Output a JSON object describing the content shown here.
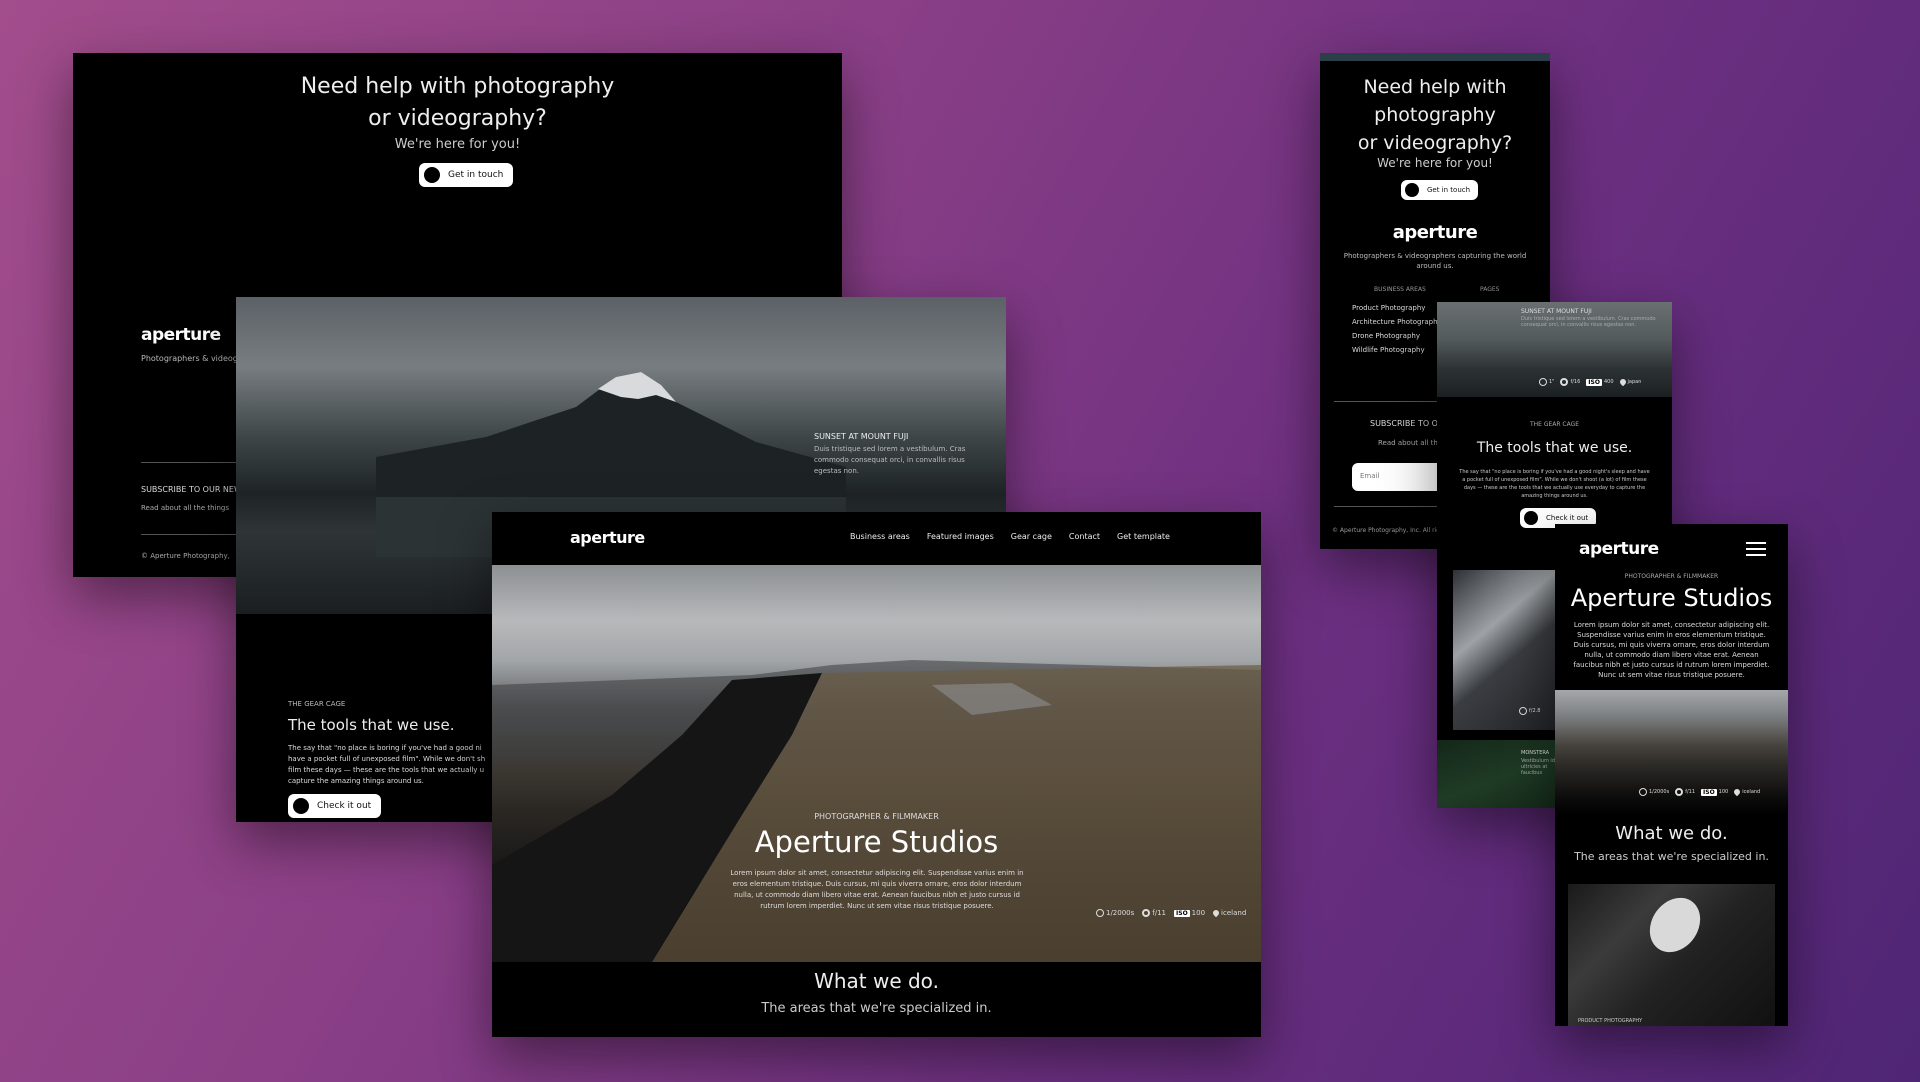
{
  "screen_footer_desktop": {
    "cta_title_line1": "Need help with photography",
    "cta_title_line2": "or videography?",
    "cta_subtitle": "We're here for you!",
    "cta_button": "Get in touch",
    "logo": "aperture",
    "tagline": "Photographers & videogr",
    "subscribe_heading": "SUBSCRIBE TO OUR NEW",
    "subscribe_text": "Read about all the things",
    "copyright": "© Aperture Photography,"
  },
  "screen_featured_desktop": {
    "caption_title": "SUNSET AT MOUNT FUJI",
    "caption_text": "Duis tristique sed lorem a vestibulum. Cras commodo consequat orci, in convallis risus egestas non.",
    "gear_eyebrow": "THE GEAR CAGE",
    "gear_title": "The tools that we use.",
    "gear_text": "The say that \"no place is boring if you've had a good ni have a pocket full of unexposed film\". While we don't sh film these days — these are the tools that we actually u capture the amazing things around us.",
    "gear_button": "Check it out"
  },
  "screen_hero_desktop": {
    "logo": "aperture",
    "nav": [
      "Business areas",
      "Featured images",
      "Gear cage",
      "Contact",
      "Get template"
    ],
    "eyebrow": "PHOTOGRAPHER & FILMMAKER",
    "title": "Aperture Studios",
    "text": "Lorem ipsum dolor sit amet, consectetur adipiscing elit. Suspendisse varius enim in eros elementum tristique. Duis cursus, mi quis viverra ornare, eros dolor interdum nulla, ut commodo diam libero vitae erat. Aenean faucibus nibh et justo cursus id rutrum lorem imperdiet. Nunc ut sem vitae risus tristique posuere.",
    "meta": {
      "shutter": "1/2000s",
      "aperture": "f/11",
      "iso_label": "ISO",
      "iso": "100",
      "location": "iceland"
    },
    "section_title": "What we do.",
    "section_sub": "The areas that we're specialized in."
  },
  "screen_footer_mobile": {
    "cta_title_line1": "Need help with",
    "cta_title_line2": "photography",
    "cta_title_line3": "or videography?",
    "cta_subtitle": "We're here for you!",
    "cta_button": "Get in touch",
    "logo": "aperture",
    "tagline": "Photographers & videographers capturing the world around us.",
    "col_business": "BUSINESS AREAS",
    "col_pages": "PAGES",
    "business_links": [
      "Product Photography",
      "Architecture Photography",
      "Drone Photography",
      "Wildlife Photography"
    ],
    "subscribe_heading": "SUBSCRIBE TO O",
    "subscribe_text": "Read about all th",
    "email_placeholder": "Email",
    "copyright": "© Aperture Photography, Inc. All rights reserved"
  },
  "screen_gear_tablet": {
    "caption_title": "SUNSET AT MOUNT FUJI",
    "caption_text": "Duis tristique sed lorem a vestibulum. Cras commodo consequat orci, in convallis risus egestas non.",
    "meta": {
      "shutter": "1\"",
      "aperture": "f/16",
      "iso_label": "ISO",
      "iso": "400",
      "location": "japan"
    },
    "eyebrow": "THE GEAR CAGE",
    "title": "The tools that we use.",
    "text": "The say that \"no place is boring if you've had a good night's sleep and have a pocket full of unexposed film\". While we don't shoot (a lot) of film these days — these are the tools that we actually use everyday to capture the amazing things around us.",
    "button": "Check it out",
    "laptop_meta": {
      "aperture": "f/2.8"
    },
    "plant_caption_title": "MONSTERA",
    "plant_caption_text": "Vestibulum id ultricies at faucibus"
  },
  "screen_hero_mobile": {
    "logo": "aperture",
    "eyebrow": "PHOTOGRAPHER & FILMMAKER",
    "title": "Aperture Studios",
    "text": "Lorem ipsum dolor sit amet, consectetur adipiscing elit. Suspendisse varius enim in eros elementum tristique. Duis cursus, mi quis viverra ornare, eros dolor interdum nulla, ut commodo diam libero vitae erat. Aenean faucibus nibh et justo cursus id rutrum lorem imperdiet. Nunc ut sem vitae risus tristique posuere.",
    "meta": {
      "shutter": "1/2000s",
      "aperture": "f/11",
      "iso_label": "ISO",
      "iso": "100",
      "location": "iceland"
    },
    "section_title": "What we do.",
    "section_sub": "The areas that we're specialized in.",
    "product_caption": "PRODUCT PHOTOGRAPHY"
  }
}
